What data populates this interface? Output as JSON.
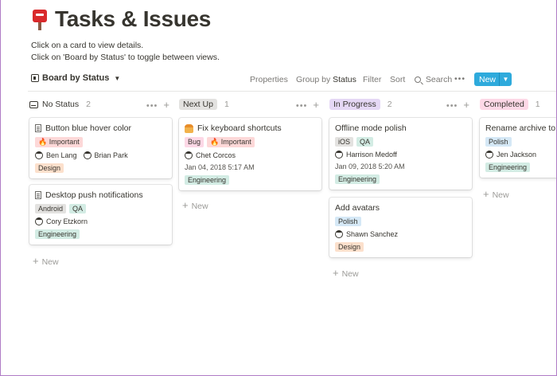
{
  "page": {
    "title": "Tasks & Issues",
    "desc_line1": "Click on a card to view details.",
    "desc_line2": "Click on 'Board by Status' to toggle between views."
  },
  "toolbar": {
    "view_label": "Board by Status",
    "properties": "Properties",
    "group_by_prefix": "Group by",
    "group_by_value": "Status",
    "filter": "Filter",
    "sort": "Sort",
    "search": "Search",
    "more": "•••",
    "new_label": "New",
    "new_chevron": "▼"
  },
  "columns": [
    {
      "name": "No Status",
      "count": "2",
      "add_new": "New",
      "cards": [
        {
          "title": "Button blue hover color",
          "tags": [
            "🔥 Important"
          ],
          "people": [
            "Ben Lang",
            "Brian Park"
          ],
          "tags2": [
            "Design"
          ]
        },
        {
          "title": "Desktop push notifications",
          "tags": [
            "Android",
            "QA"
          ],
          "people": [
            "Cory Etzkorn"
          ],
          "tags2": [
            "Engineering"
          ]
        }
      ]
    },
    {
      "name": "Next Up",
      "count": "1",
      "add_new": "New",
      "cards": [
        {
          "title": "Fix keyboard shortcuts",
          "tags": [
            "Bug",
            "🔥 Important"
          ],
          "people": [
            "Chet Corcos"
          ],
          "date": "Jan 04, 2018 5:17 AM",
          "tags2": [
            "Engineering"
          ]
        }
      ]
    },
    {
      "name": "In Progress",
      "count": "2",
      "add_new": "New",
      "cards": [
        {
          "title": "Offline mode polish",
          "tags": [
            "iOS",
            "QA"
          ],
          "people": [
            "Harrison Medoff"
          ],
          "date": "Jan 09, 2018 5:20 AM",
          "tags2": [
            "Engineering"
          ]
        },
        {
          "title": "Add avatars",
          "tags": [
            "Polish"
          ],
          "people": [
            "Shawn Sanchez"
          ],
          "tags2": [
            "Design"
          ]
        }
      ]
    },
    {
      "name": "Completed",
      "count": "1",
      "add_new": "New",
      "cards": [
        {
          "title": "Rename archive to t",
          "tags": [
            "Polish"
          ],
          "people": [
            "Jen Jackson"
          ],
          "tags2": [
            "Engineering"
          ]
        }
      ]
    }
  ],
  "colors": {
    "accent": "#2eaadc",
    "no_status": "#ffffff",
    "next_up": "#e3e2e0",
    "in_progress": "#e5d8f5",
    "completed": "#fdd8e6"
  },
  "icons": {
    "title": "mailbox-icon",
    "board": "board-icon",
    "search": "search-icon",
    "inbox": "inbox-icon",
    "document": "document-icon",
    "worker": "construction-worker-icon",
    "avatar": "avatar-icon"
  }
}
